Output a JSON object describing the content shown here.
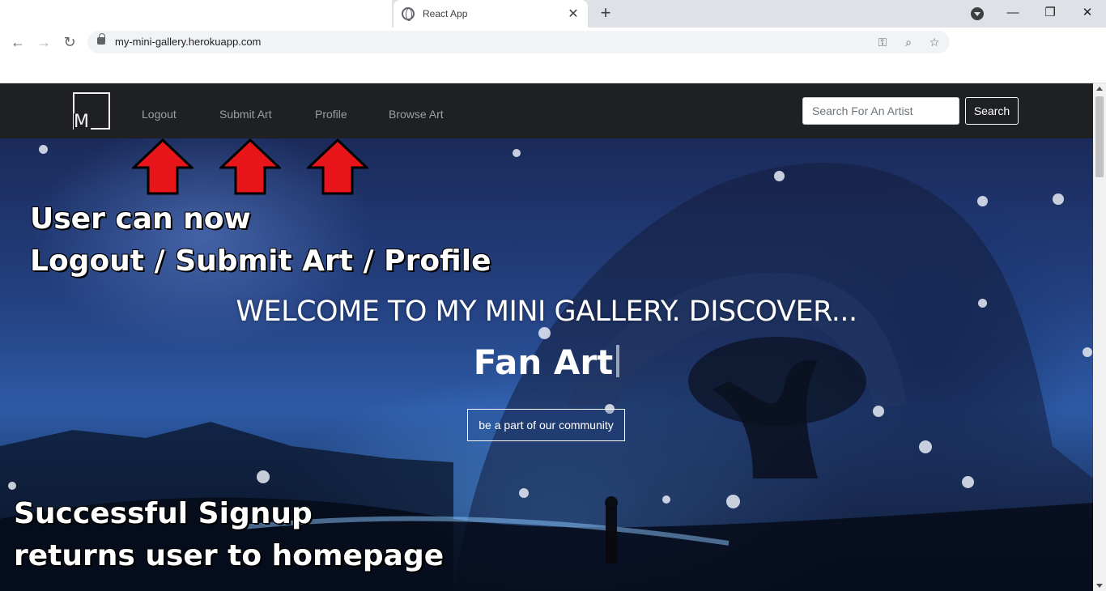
{
  "browser": {
    "tab_title": "React App",
    "tab_close": "✕",
    "new_tab": "+",
    "url": "my-mini-gallery.herokuapp.com",
    "window": {
      "minimize": "—",
      "maximize": "❐",
      "close": "✕"
    },
    "nav": {
      "back": "←",
      "forward": "→",
      "reload": "↻"
    },
    "omnibox_icons": {
      "key": "⚿",
      "zoom": "⌕",
      "star": "☆"
    }
  },
  "navbar": {
    "logo_letter": "M",
    "links": {
      "logout": "Logout",
      "submit_art": "Submit Art",
      "profile": "Profile",
      "browse_art": "Browse Art"
    },
    "search": {
      "placeholder": "Search For An Artist",
      "button_label": "Search"
    }
  },
  "hero": {
    "welcome": "WELCOME TO MY MINI GALLERY. DISCOVER...",
    "typed_word": "Fan Art",
    "cta_label": "be a part of our community"
  },
  "annotations": {
    "top_line1": "User can now",
    "top_line2": "Logout / Submit Art / Profile",
    "bottom_line1": "Successful Signup",
    "bottom_line2": "returns user to homepage",
    "arrow_color": "#e8151b"
  },
  "colors": {
    "navbar_bg": "#1e2024",
    "nav_link": "#9b9ea3"
  }
}
